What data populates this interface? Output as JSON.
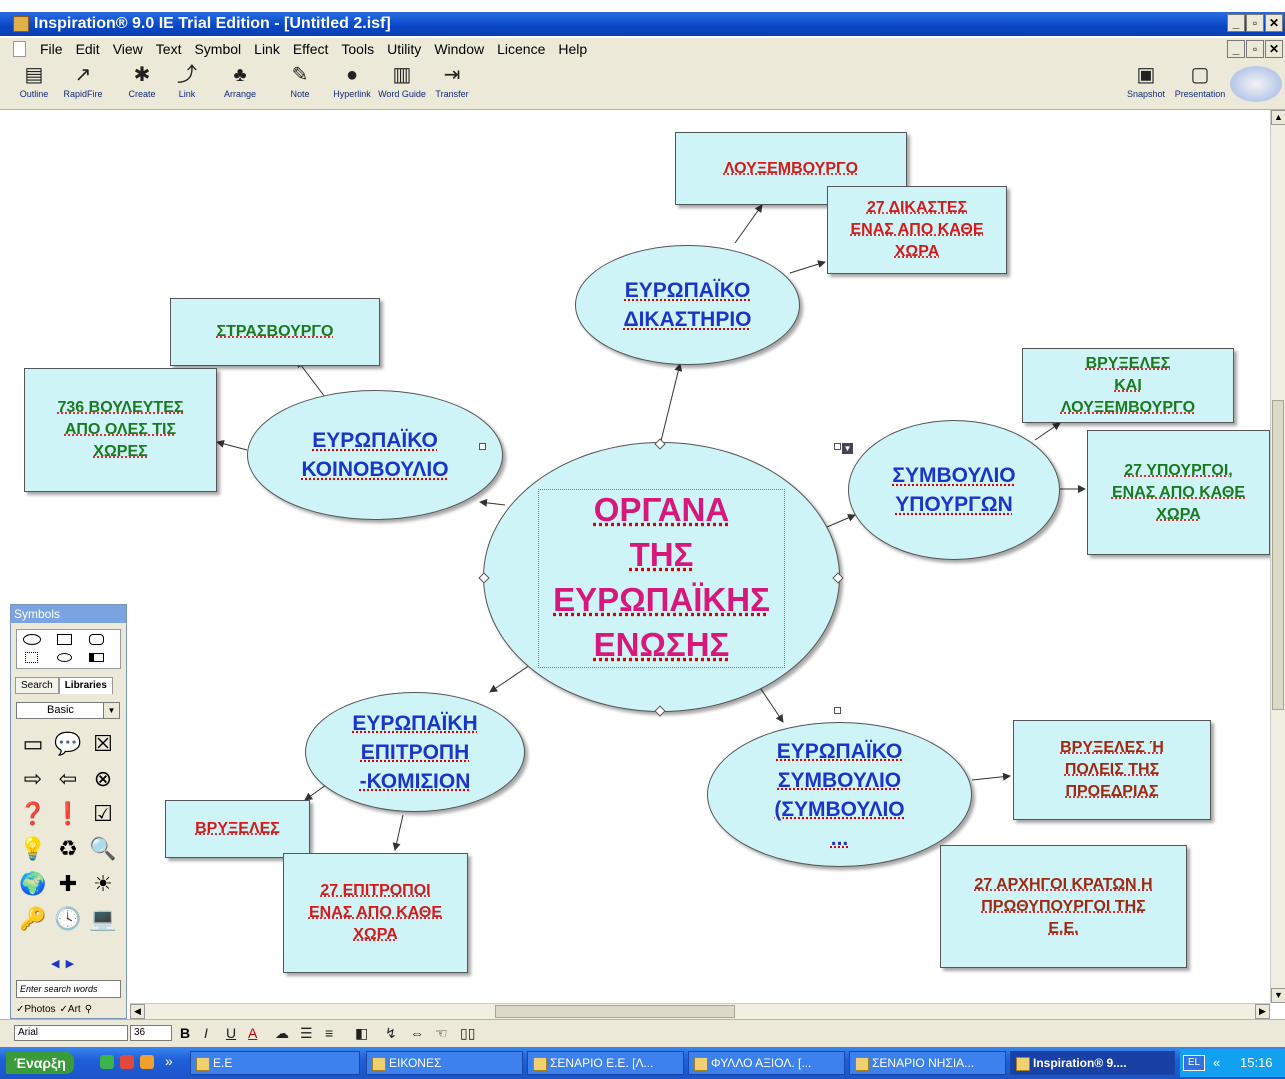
{
  "window": {
    "title": "Inspiration® 9.0 IE Trial Edition - [Untitled 2.isf]",
    "min": "_",
    "max": "▫",
    "close": "✕"
  },
  "menu": [
    "File",
    "Edit",
    "View",
    "Text",
    "Symbol",
    "Link",
    "Effect",
    "Tools",
    "Utility",
    "Window",
    "Licence",
    "Help"
  ],
  "toolbar": {
    "outline": "Outline",
    "rapidfire": "RapidFire",
    "create": "Create",
    "link": "Link",
    "arrange": "Arrange",
    "note": "Note",
    "hyperlink": "Hyperlink",
    "wordguide": "Word Guide",
    "transfer": "Transfer",
    "snapshot": "Snapshot",
    "presentation": "Presentation"
  },
  "map": {
    "center": "ΟΡΓΑΝΑ\nΤΗΣ\nΕΥΡΩΠΑΪΚΗΣ\nΕΝΩΣΗΣ",
    "court": "ΕΥΡΩΠΑΪΚΟ\nΔΙΚΑΣΤΗΡΙΟ",
    "court_city": "ΛΟΥΞΕΜΒΟΥΡΓΟ",
    "court_judges": "27 ΔΙΚΑΣΤΕΣ\nΕΝΑΣ ΑΠΟ ΚΑΘΕ\nΧΩΡΑ",
    "parliament": "ΕΥΡΩΠΑΪΚΟ\nΚΟΙΝΟΒΟΥΛΙΟ",
    "parl_city": "ΣΤΡΑΣΒΟΥΡΓΟ",
    "parl_members": "736 ΒΟΥΛΕΥΤΕΣ\nΑΠΟ ΟΛΕΣ ΤΙΣ\nΧΩΡΕΣ",
    "council": "ΣΥΜΒΟΥΛΙΟ\nΥΠΟΥΡΓΩΝ",
    "council_city": "ΒΡΥΞΕΛΕΣ\nΚΑΙ\nΛΟΥΞΕΜΒΟΥΡΓΟ",
    "council_members": "27 ΥΠΟΥΡΓΟΙ,\nΕΝΑΣ ΑΠΟ ΚΑΘΕ\nΧΩΡΑ",
    "commission": "ΕΥΡΩΠΑΪΚΗ\nΕΠΙΤΡΟΠΗ\n-ΚΟΜΙΣΙΟΝ",
    "comm_city": "ΒΡΥΞΕΛΕΣ",
    "comm_members": "27 ΕΠΙΤΡΟΠΟΙ\nΕΝΑΣ ΑΠΟ ΚΑΘΕ\nΧΩΡΑ",
    "eucouncil": "ΕΥΡΩΠΑΪΚΟ\nΣΥΜΒΟΥΛΙΟ\n(ΣΥΜΒΟΥΛΙΟ\n...",
    "euc_city": "ΒΡΥΞΕΛΕΣ Ή\nΠΟΛΕΙΣ ΤΗΣ\nΠΡΟΕΔΡΙΑΣ",
    "euc_members": "27 ΑΡΧΗΓΟΙ ΚΡΑΤΩΝ Η\nΠΡΩΘΥΠΟΥΡΓΟΙ ΤΗΣ\nΕ.Ε."
  },
  "symbols": {
    "title": "Symbols",
    "tab_search": "Search",
    "tab_libraries": "Libraries",
    "library": "Basic",
    "search_placeholder": "Enter search words",
    "photos": "Photos",
    "art": "Art"
  },
  "format": {
    "font": "Arial",
    "size": "36",
    "bold": "B",
    "italic": "I",
    "underline": "U",
    "color": "A"
  },
  "taskbar": {
    "start": "Έναρξη",
    "tasks": [
      "E.E",
      "ΕΙΚΟΝΕΣ",
      "ΣΕΝΑΡΙΟ Ε.Ε. [Λ...",
      "ΦΥΛΛΟ ΑΞΙΟΛ. [...",
      "ΣΕΝΑΡΙΟ ΝΗΣΙΑ...",
      "Inspiration® 9...."
    ],
    "lang": "EL",
    "time": "15:16",
    "more": "»",
    "tray_more": "«"
  },
  "colors": {
    "node_fill": "#cff4f7",
    "title_blue": "#1b35c8",
    "center_pink": "#d8177a"
  }
}
